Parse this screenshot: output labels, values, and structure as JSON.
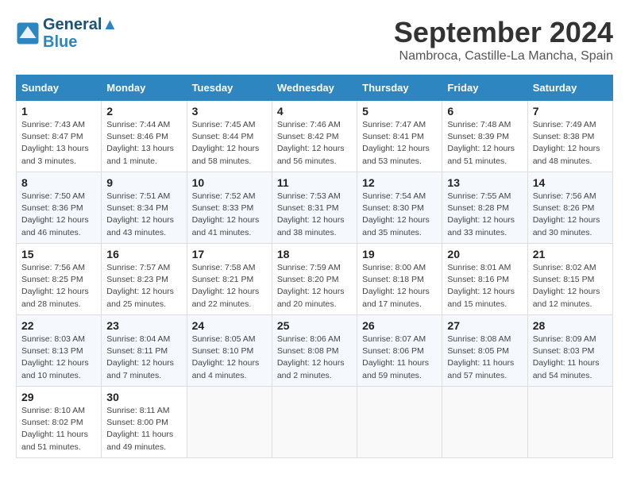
{
  "header": {
    "logo_line1": "General",
    "logo_line2": "Blue",
    "month_year": "September 2024",
    "location": "Nambroca, Castille-La Mancha, Spain"
  },
  "days_of_week": [
    "Sunday",
    "Monday",
    "Tuesday",
    "Wednesday",
    "Thursday",
    "Friday",
    "Saturday"
  ],
  "weeks": [
    [
      {
        "day": "1",
        "sunrise": "7:43 AM",
        "sunset": "8:47 PM",
        "daylight": "13 hours and 3 minutes."
      },
      {
        "day": "2",
        "sunrise": "7:44 AM",
        "sunset": "8:46 PM",
        "daylight": "13 hours and 1 minute."
      },
      {
        "day": "3",
        "sunrise": "7:45 AM",
        "sunset": "8:44 PM",
        "daylight": "12 hours and 58 minutes."
      },
      {
        "day": "4",
        "sunrise": "7:46 AM",
        "sunset": "8:42 PM",
        "daylight": "12 hours and 56 minutes."
      },
      {
        "day": "5",
        "sunrise": "7:47 AM",
        "sunset": "8:41 PM",
        "daylight": "12 hours and 53 minutes."
      },
      {
        "day": "6",
        "sunrise": "7:48 AM",
        "sunset": "8:39 PM",
        "daylight": "12 hours and 51 minutes."
      },
      {
        "day": "7",
        "sunrise": "7:49 AM",
        "sunset": "8:38 PM",
        "daylight": "12 hours and 48 minutes."
      }
    ],
    [
      {
        "day": "8",
        "sunrise": "7:50 AM",
        "sunset": "8:36 PM",
        "daylight": "12 hours and 46 minutes."
      },
      {
        "day": "9",
        "sunrise": "7:51 AM",
        "sunset": "8:34 PM",
        "daylight": "12 hours and 43 minutes."
      },
      {
        "day": "10",
        "sunrise": "7:52 AM",
        "sunset": "8:33 PM",
        "daylight": "12 hours and 41 minutes."
      },
      {
        "day": "11",
        "sunrise": "7:53 AM",
        "sunset": "8:31 PM",
        "daylight": "12 hours and 38 minutes."
      },
      {
        "day": "12",
        "sunrise": "7:54 AM",
        "sunset": "8:30 PM",
        "daylight": "12 hours and 35 minutes."
      },
      {
        "day": "13",
        "sunrise": "7:55 AM",
        "sunset": "8:28 PM",
        "daylight": "12 hours and 33 minutes."
      },
      {
        "day": "14",
        "sunrise": "7:56 AM",
        "sunset": "8:26 PM",
        "daylight": "12 hours and 30 minutes."
      }
    ],
    [
      {
        "day": "15",
        "sunrise": "7:56 AM",
        "sunset": "8:25 PM",
        "daylight": "12 hours and 28 minutes."
      },
      {
        "day": "16",
        "sunrise": "7:57 AM",
        "sunset": "8:23 PM",
        "daylight": "12 hours and 25 minutes."
      },
      {
        "day": "17",
        "sunrise": "7:58 AM",
        "sunset": "8:21 PM",
        "daylight": "12 hours and 22 minutes."
      },
      {
        "day": "18",
        "sunrise": "7:59 AM",
        "sunset": "8:20 PM",
        "daylight": "12 hours and 20 minutes."
      },
      {
        "day": "19",
        "sunrise": "8:00 AM",
        "sunset": "8:18 PM",
        "daylight": "12 hours and 17 minutes."
      },
      {
        "day": "20",
        "sunrise": "8:01 AM",
        "sunset": "8:16 PM",
        "daylight": "12 hours and 15 minutes."
      },
      {
        "day": "21",
        "sunrise": "8:02 AM",
        "sunset": "8:15 PM",
        "daylight": "12 hours and 12 minutes."
      }
    ],
    [
      {
        "day": "22",
        "sunrise": "8:03 AM",
        "sunset": "8:13 PM",
        "daylight": "12 hours and 10 minutes."
      },
      {
        "day": "23",
        "sunrise": "8:04 AM",
        "sunset": "8:11 PM",
        "daylight": "12 hours and 7 minutes."
      },
      {
        "day": "24",
        "sunrise": "8:05 AM",
        "sunset": "8:10 PM",
        "daylight": "12 hours and 4 minutes."
      },
      {
        "day": "25",
        "sunrise": "8:06 AM",
        "sunset": "8:08 PM",
        "daylight": "12 hours and 2 minutes."
      },
      {
        "day": "26",
        "sunrise": "8:07 AM",
        "sunset": "8:06 PM",
        "daylight": "11 hours and 59 minutes."
      },
      {
        "day": "27",
        "sunrise": "8:08 AM",
        "sunset": "8:05 PM",
        "daylight": "11 hours and 57 minutes."
      },
      {
        "day": "28",
        "sunrise": "8:09 AM",
        "sunset": "8:03 PM",
        "daylight": "11 hours and 54 minutes."
      }
    ],
    [
      {
        "day": "29",
        "sunrise": "8:10 AM",
        "sunset": "8:02 PM",
        "daylight": "11 hours and 51 minutes."
      },
      {
        "day": "30",
        "sunrise": "8:11 AM",
        "sunset": "8:00 PM",
        "daylight": "11 hours and 49 minutes."
      },
      null,
      null,
      null,
      null,
      null
    ]
  ],
  "labels": {
    "sunrise_prefix": "Sunrise: ",
    "sunset_prefix": "Sunset: ",
    "daylight_prefix": "Daylight: "
  }
}
